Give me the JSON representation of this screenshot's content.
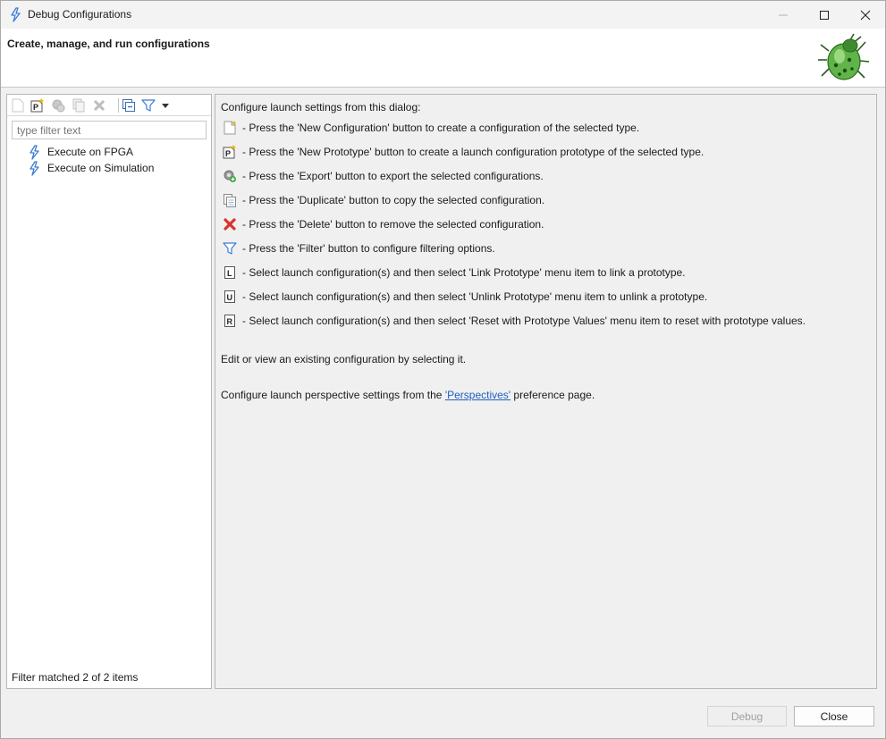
{
  "window": {
    "title": "Debug Configurations"
  },
  "banner": {
    "title": "Create, manage, and run configurations"
  },
  "left": {
    "filter_placeholder": "type filter text",
    "tree": [
      {
        "label": "Execute on FPGA",
        "icon": "launch-config-icon"
      },
      {
        "label": "Execute on Simulation",
        "icon": "launch-config-icon"
      }
    ],
    "status": "Filter matched 2 of 2 items"
  },
  "toolbar": {
    "buttons": [
      "new-config-icon",
      "new-prototype-icon",
      "export-icon",
      "duplicate-icon",
      "delete-icon",
      "collapse-all-icon",
      "filter-icon",
      "dropdown-arrow-icon"
    ]
  },
  "main": {
    "intro": "Configure launch settings from this dialog:",
    "items": [
      {
        "icon": "new-config-icon",
        "text": "- Press the 'New Configuration' button to create a configuration of the selected type."
      },
      {
        "icon": "new-prototype-icon",
        "text": "- Press the 'New Prototype' button to create a launch configuration prototype of the selected type."
      },
      {
        "icon": "export-icon",
        "text": "- Press the 'Export' button to export the selected configurations."
      },
      {
        "icon": "duplicate-icon",
        "text": "- Press the 'Duplicate' button to copy the selected configuration."
      },
      {
        "icon": "delete-icon",
        "text": "- Press the 'Delete' button to remove the selected configuration."
      },
      {
        "icon": "filter-icon",
        "text": "- Press the 'Filter' button to configure filtering options."
      },
      {
        "icon": "link-prototype-icon",
        "text": "- Select launch configuration(s) and then select 'Link Prototype' menu item to link a prototype."
      },
      {
        "icon": "unlink-prototype-icon",
        "text": "- Select launch configuration(s) and then select 'Unlink Prototype' menu item to unlink a prototype."
      },
      {
        "icon": "reset-prototype-icon",
        "text": "- Select launch configuration(s) and then select 'Reset with Prototype Values' menu item to reset with prototype values."
      }
    ],
    "edit_text": "Edit or view an existing configuration by selecting it.",
    "perspective_prefix": "Configure launch perspective settings from the ",
    "perspective_link": "'Perspectives'",
    "perspective_suffix": " preference page."
  },
  "buttons": {
    "debug": "Debug",
    "close": "Close"
  },
  "colors": {
    "link": "#1f5fbf",
    "delete_red": "#d9322e",
    "bug_green": "#3c9a2b"
  }
}
